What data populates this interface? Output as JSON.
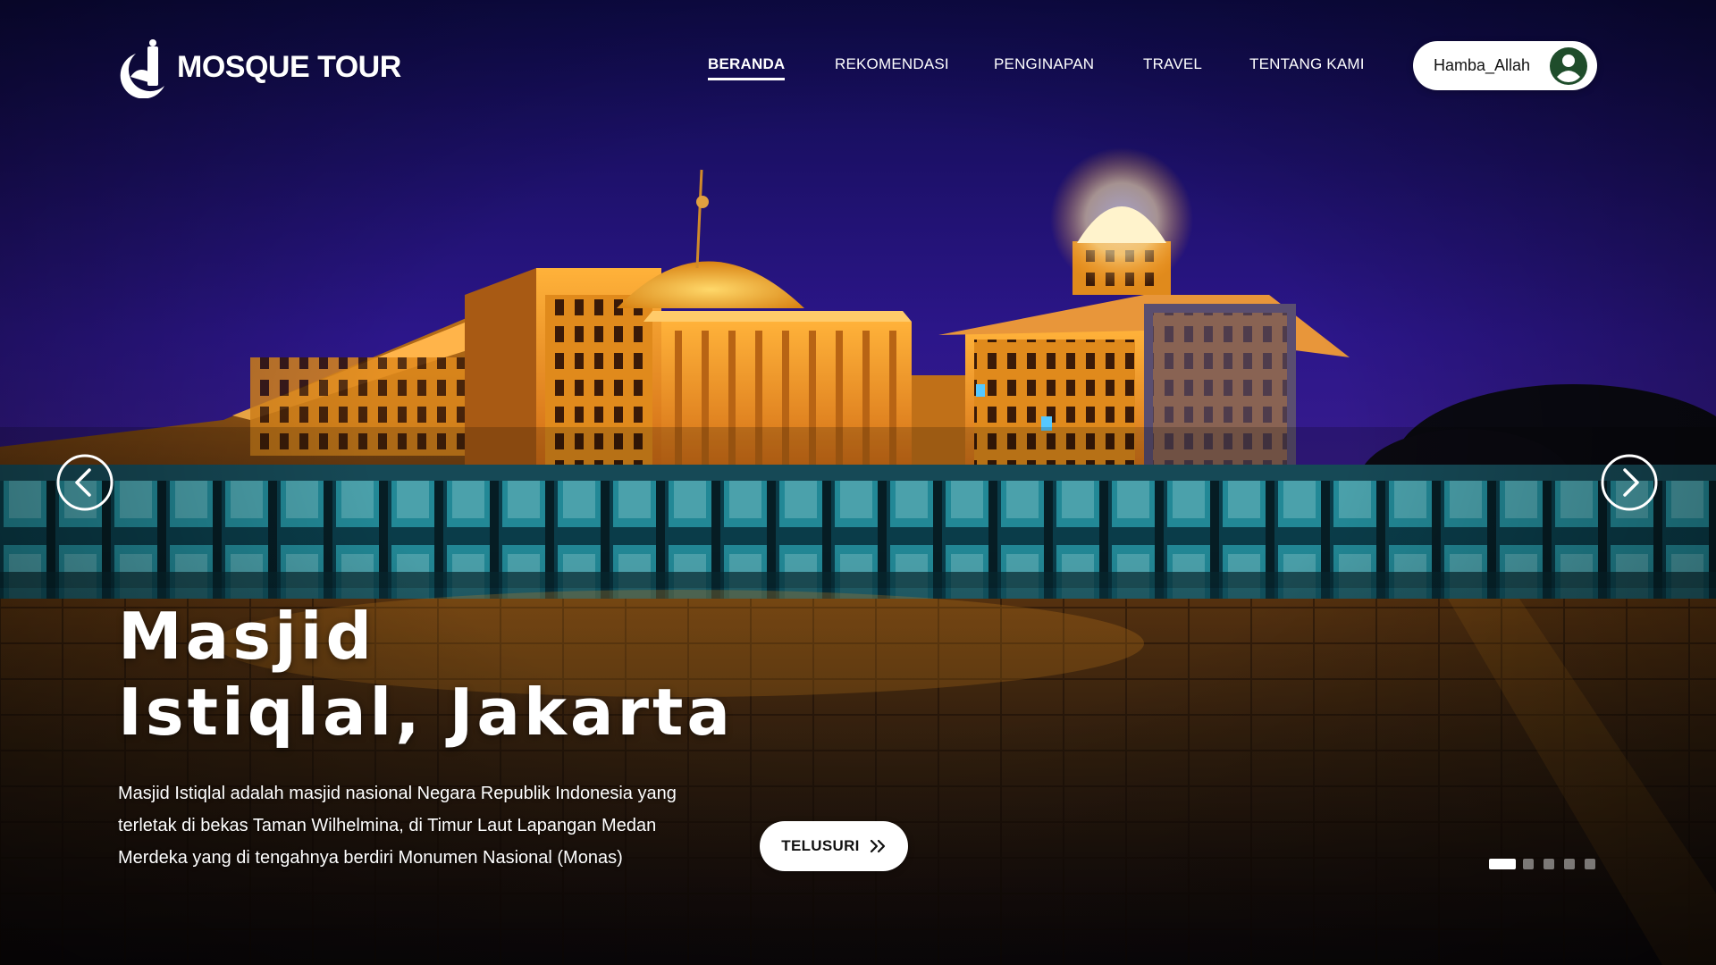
{
  "brand": {
    "name": "MOSQUE TOUR",
    "logo_icon": "mosque-logo-icon"
  },
  "nav": {
    "items": [
      {
        "label": "BERANDA",
        "active": true
      },
      {
        "label": "REKOMENDASI",
        "active": false
      },
      {
        "label": "PENGINAPAN",
        "active": false
      },
      {
        "label": "TRAVEL",
        "active": false
      },
      {
        "label": "TENTANG KAMI",
        "active": false
      }
    ]
  },
  "user": {
    "name": "Hamba_Allah",
    "avatar_icon": "user-circle-icon",
    "avatar_color": "#1f4d2b"
  },
  "carousel": {
    "prev_icon": "chevron-left-circle-icon",
    "next_icon": "chevron-right-circle-icon",
    "slide_count": 5,
    "active_index": 0
  },
  "slide": {
    "title_line1": "Masjid",
    "title_line2": "Istiqlal, Jakarta",
    "description": "Masjid Istiqlal adalah masjid nasional Negara Republik Indonesia yang terletak di bekas Taman Wilhelmina, di Timur Laut Lapangan Medan Merdeka yang di tengahnya berdiri Monumen Nasional (Monas)",
    "cta_label": "TELUSURI",
    "cta_icon": "double-chevron-right-icon"
  },
  "colors": {
    "sky_top": "#1a1060",
    "sky_mid": "#3a1a8a",
    "building_glow": "#f59a1a",
    "accent_white": "#ffffff"
  }
}
